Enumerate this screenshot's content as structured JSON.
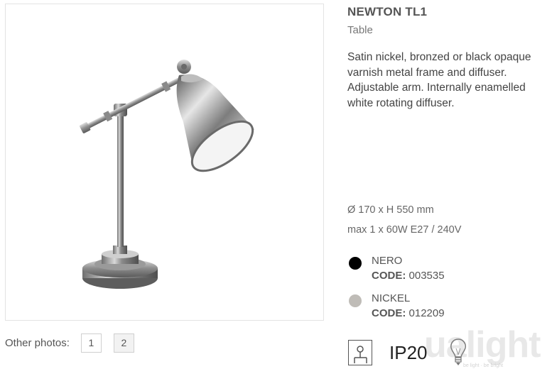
{
  "product": {
    "title": "NEWTON TL1",
    "category": "Table",
    "description": "Satin nickel, bronzed or black opaque varnish metal frame and diffuser. Adjustable arm. Internally enamelled white rotating diffuser."
  },
  "specs": {
    "dimensions": "Ø 170 x H 550 mm",
    "power": "max 1 x 60W E27 / 240V"
  },
  "variants": [
    {
      "name": "NERO",
      "code_label": "CODE:",
      "code": "003535",
      "color": "#000000"
    },
    {
      "name": "NICKEL",
      "code_label": "CODE:",
      "code": "012209",
      "color": "#bfbcb7"
    }
  ],
  "gallery": {
    "label": "Other photos:",
    "pages": [
      "1",
      "2"
    ]
  },
  "ip_rating": "IP20",
  "watermark": {
    "text": "ualight",
    "subtext": "be light · be bright"
  },
  "icons": {
    "protection_class": "class-symbol-icon",
    "bulb": "lightbulb-icon"
  }
}
